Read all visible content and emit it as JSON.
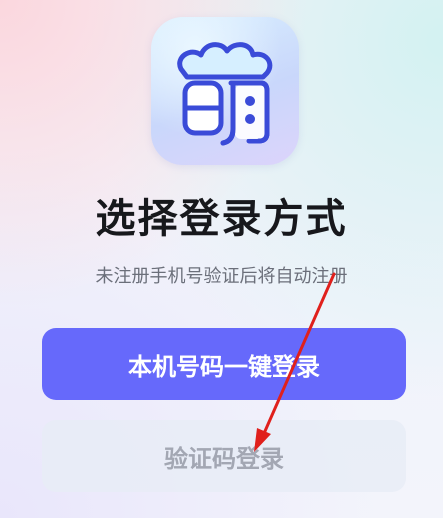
{
  "app": {
    "icon_name": "app-logo-meng-icon",
    "icon_glyph": "萌"
  },
  "header": {
    "title": "选择登录方式",
    "subtitle": "未注册手机号验证后将自动注册"
  },
  "actions": {
    "one_click_label": "本机号码一键登录",
    "sms_code_label": "验证码登录"
  },
  "annotation": {
    "arrow_color": "#e0201c"
  },
  "colors": {
    "primary": "#6669fb",
    "secondary_bg": "#e8ecf6",
    "title": "#17181c"
  }
}
